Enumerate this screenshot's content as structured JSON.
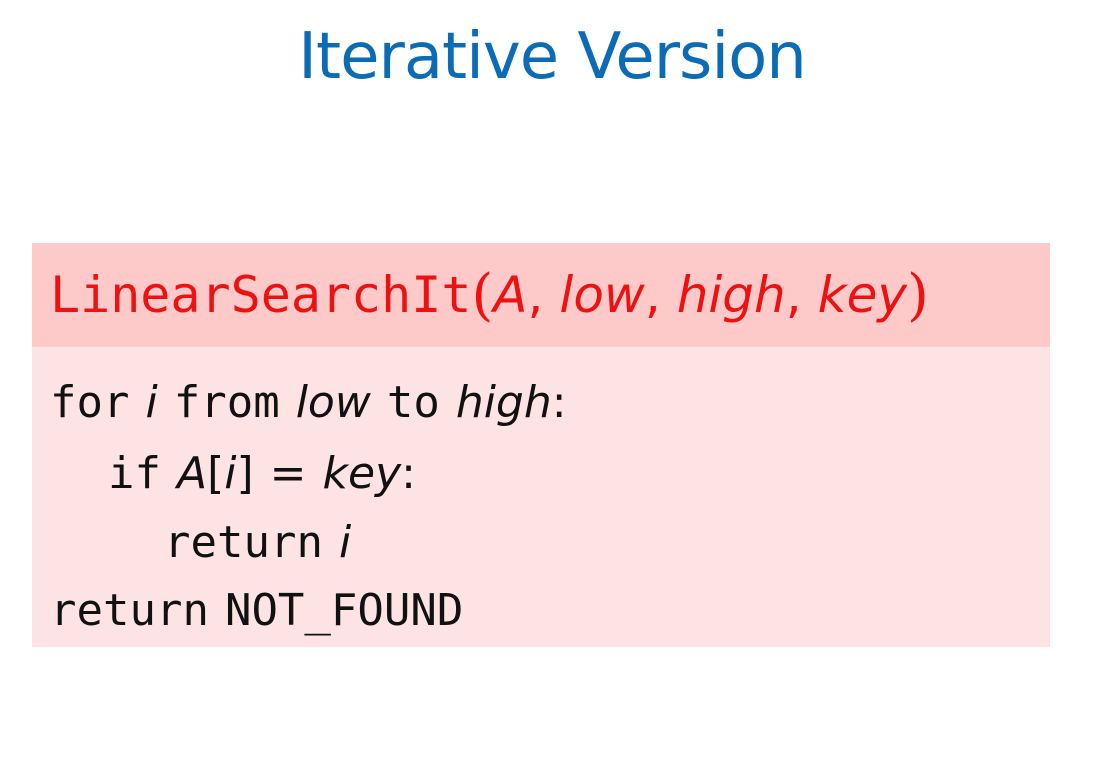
{
  "slide": {
    "title": "Iterative Version"
  },
  "algorithm": {
    "name": "LinearSearchIt",
    "open_paren": "(",
    "params": [
      "A",
      "low",
      "high",
      "key"
    ],
    "separator": ",",
    "close_paren": ")",
    "lines": [
      {
        "kw1": "for",
        "var": "i",
        "kw2": "from",
        "lo": "low",
        "kw3": "to",
        "hi": "high",
        "colon": ":"
      },
      {
        "kw": "if",
        "arr": "A",
        "lb": "[",
        "idx": "i",
        "rb": "]",
        "eq": "=",
        "key": "key",
        "colon": ":"
      },
      {
        "kw": "return",
        "var": "i"
      },
      {
        "kw": "return",
        "const": "NOT_FOUND"
      }
    ]
  },
  "colors": {
    "title": "#0b6bb5",
    "header_bg": "#fdc9c9",
    "body_bg": "#fde3e3",
    "header_text": "#ee1111",
    "code_text": "#111111"
  }
}
